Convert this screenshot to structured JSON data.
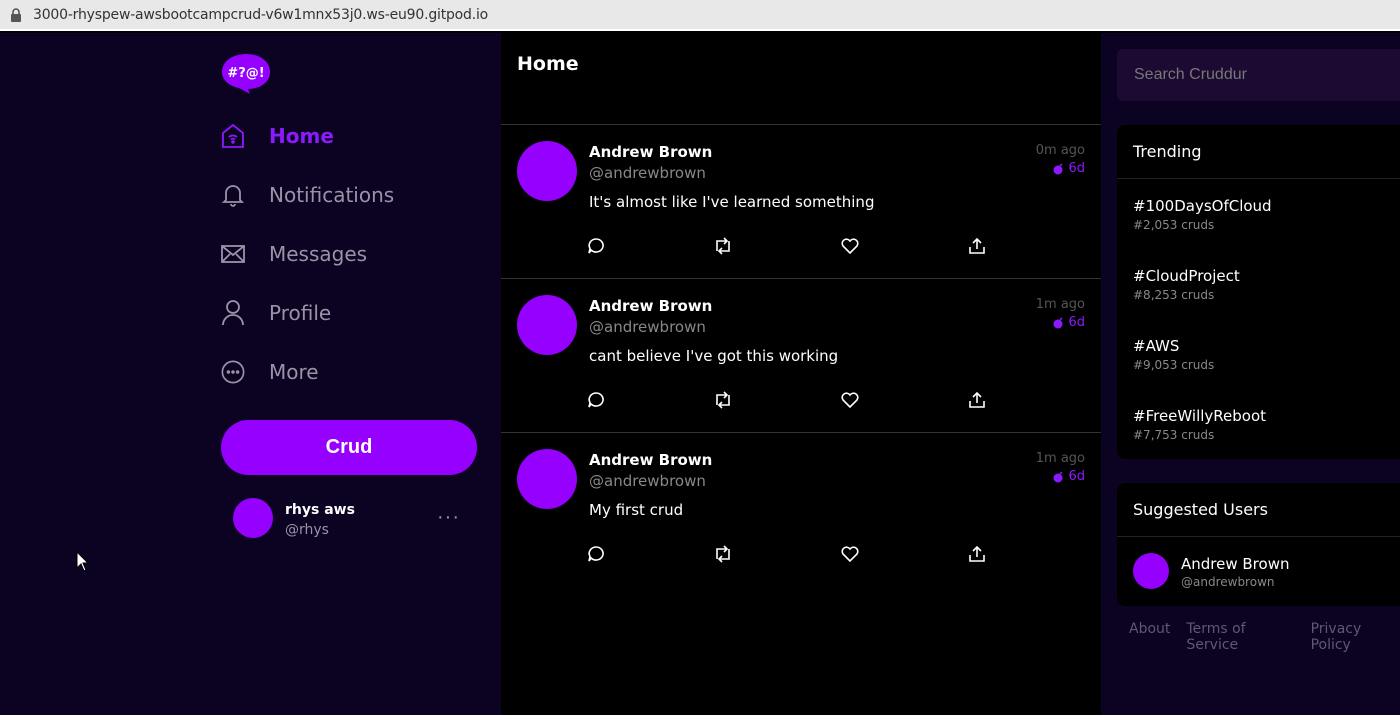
{
  "browser": {
    "url": "3000-rhyspew-awsbootcampcrud-v6w1mnx53j0.ws-eu90.gitpod.io"
  },
  "logo": {
    "text": "#?@!"
  },
  "nav": {
    "items": [
      {
        "label": "Home",
        "icon": "home-icon",
        "active": true
      },
      {
        "label": "Notifications",
        "icon": "bell-icon",
        "active": false
      },
      {
        "label": "Messages",
        "icon": "envelope-icon",
        "active": false
      },
      {
        "label": "Profile",
        "icon": "person-icon",
        "active": false
      },
      {
        "label": "More",
        "icon": "more-circle-icon",
        "active": false
      }
    ],
    "crud_button": "Crud"
  },
  "current_user": {
    "display_name": "rhys aws",
    "handle": "@rhys",
    "menu": "···"
  },
  "main": {
    "title": "Home",
    "activities": [
      {
        "display_name": "Andrew Brown",
        "handle": "@andrewbrown",
        "message": "It's almost like I've learned something",
        "ago": "0m ago",
        "expires": "6d"
      },
      {
        "display_name": "Andrew Brown",
        "handle": "@andrewbrown",
        "message": "cant believe I've got this working",
        "ago": "1m ago",
        "expires": "6d"
      },
      {
        "display_name": "Andrew Brown",
        "handle": "@andrewbrown",
        "message": "My first crud",
        "ago": "1m ago",
        "expires": "6d"
      }
    ]
  },
  "search": {
    "placeholder": "Search Cruddur"
  },
  "trending": {
    "title": "Trending",
    "items": [
      {
        "tag": "#100DaysOfCloud",
        "count": "#2,053 cruds"
      },
      {
        "tag": "#CloudProject",
        "count": "#8,253 cruds"
      },
      {
        "tag": "#AWS",
        "count": "#9,053 cruds"
      },
      {
        "tag": "#FreeWillyReboot",
        "count": "#7,753 cruds"
      }
    ]
  },
  "suggested": {
    "title": "Suggested Users",
    "users": [
      {
        "display_name": "Andrew Brown",
        "handle": "@andrewbrown"
      }
    ]
  },
  "footer": {
    "links": [
      "About",
      "Terms of Service",
      "Privacy Policy"
    ]
  },
  "colors": {
    "accent": "#9500ff",
    "sidebar_bg": "#0c0222",
    "main_bg": "#000000"
  }
}
